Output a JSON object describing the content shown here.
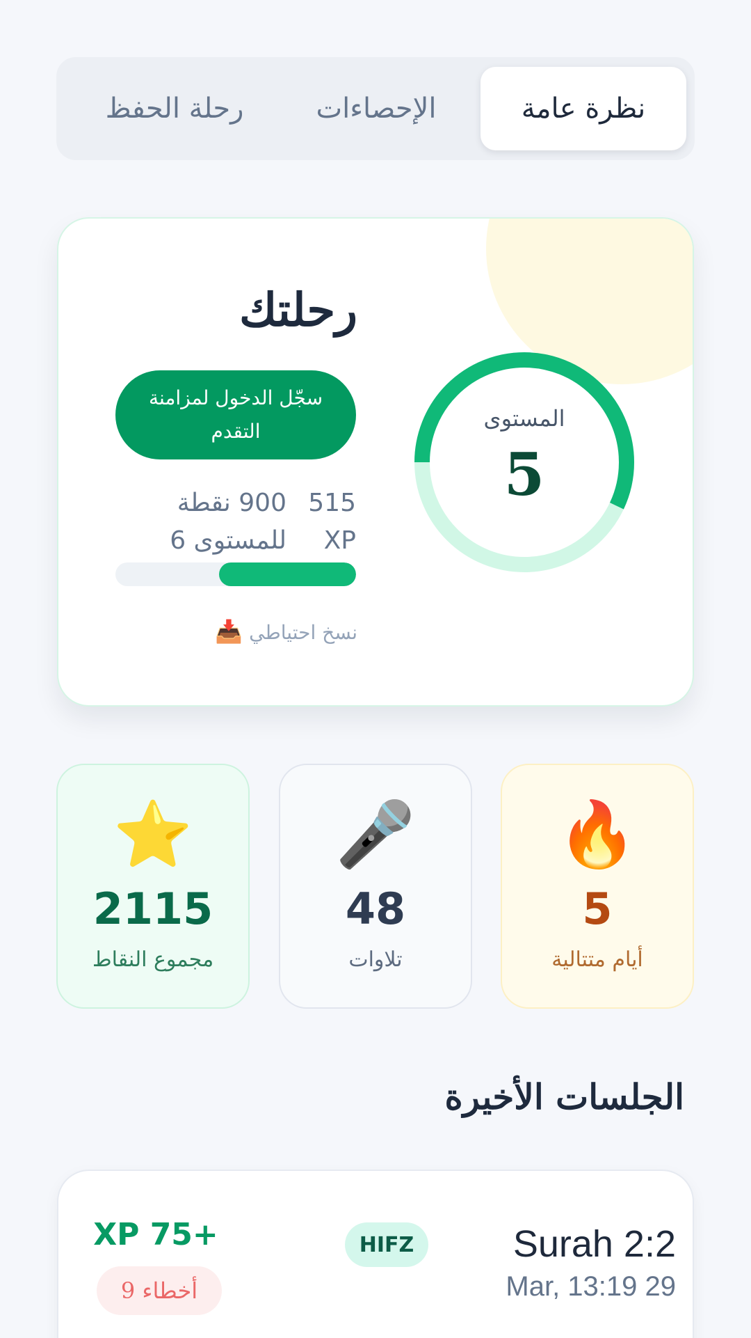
{
  "tabs": [
    {
      "label": "نظرة عامة",
      "active": true
    },
    {
      "label": "الإحصاءات",
      "active": false
    },
    {
      "label": "رحلة الحفظ",
      "active": false
    }
  ],
  "journey": {
    "title": "رحلتك",
    "login_button": "سجّل الدخول لمزامنة التقدم",
    "level_label": "المستوى",
    "level_value": "5",
    "level_progress": 0.57,
    "xp_current": "515",
    "xp_unit": "XP",
    "xp_remaining": "900 نقطة",
    "xp_next_level": "للمستوى 6",
    "xp_bar_fraction": 0.57,
    "backup_icon": "📥",
    "backup_label": "نسخ احتياطي"
  },
  "stats": {
    "streak": {
      "icon": "🔥",
      "value": "5",
      "label": "أيام متتالية"
    },
    "recitations": {
      "icon": "🎤",
      "value": "48",
      "label": "تلاوات"
    },
    "points": {
      "icon": "⭐",
      "value": "2115",
      "label": "مجموع النقاط"
    }
  },
  "recent_sessions": {
    "title": "الجلسات الأخيرة",
    "items": [
      {
        "title": "Surah 2:2",
        "date": "Mar, 13:19 29",
        "type": "HIFZ",
        "xp": "XP 75+",
        "errors": "9 أخطاء"
      }
    ]
  },
  "colors": {
    "primary_green": "#039960",
    "ring_green": "#10b978",
    "ring_track": "#d1f7e6",
    "background": "#f5f7fb"
  }
}
